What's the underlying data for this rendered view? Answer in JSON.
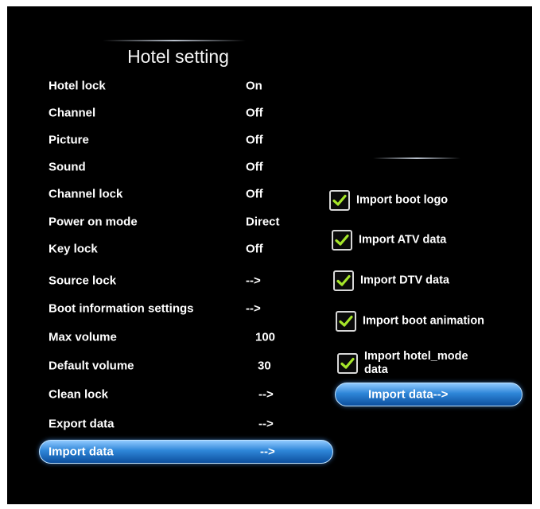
{
  "menu": {
    "title": "Hotel setting",
    "items": [
      {
        "label": "Hotel lock",
        "value": "On"
      },
      {
        "label": "Channel",
        "value": "Off"
      },
      {
        "label": "Picture",
        "value": "Off"
      },
      {
        "label": "Sound",
        "value": "Off"
      },
      {
        "label": "Channel lock",
        "value": "Off"
      },
      {
        "label": "Power on mode",
        "value": "Direct"
      },
      {
        "label": "Key lock",
        "value": "Off"
      },
      {
        "label": "Source lock",
        "value": "-->"
      },
      {
        "label": "Boot information settings",
        "value": "-->"
      },
      {
        "label": "Max volume",
        "value": "100"
      },
      {
        "label": "Default volume",
        "value": "30"
      },
      {
        "label": "Clean lock",
        "value": "-->"
      },
      {
        "label": "Export data",
        "value": "-->"
      },
      {
        "label": "Import data",
        "value": "-->"
      }
    ],
    "selected_index": 13
  },
  "import_panel": {
    "options": [
      {
        "label": "Import boot logo",
        "checked": true
      },
      {
        "label": "Import ATV data",
        "checked": true
      },
      {
        "label": "Import DTV data",
        "checked": true
      },
      {
        "label": "Import boot animation",
        "checked": true
      },
      {
        "label_line1": "Import hotel_mode",
        "label_line2": "data",
        "checked": true
      }
    ],
    "button_label": "Import data-->"
  },
  "colors": {
    "background": "#000000",
    "text": "#ffffff",
    "check_mark": "#a6e62a",
    "highlight": "#2e86d8"
  }
}
